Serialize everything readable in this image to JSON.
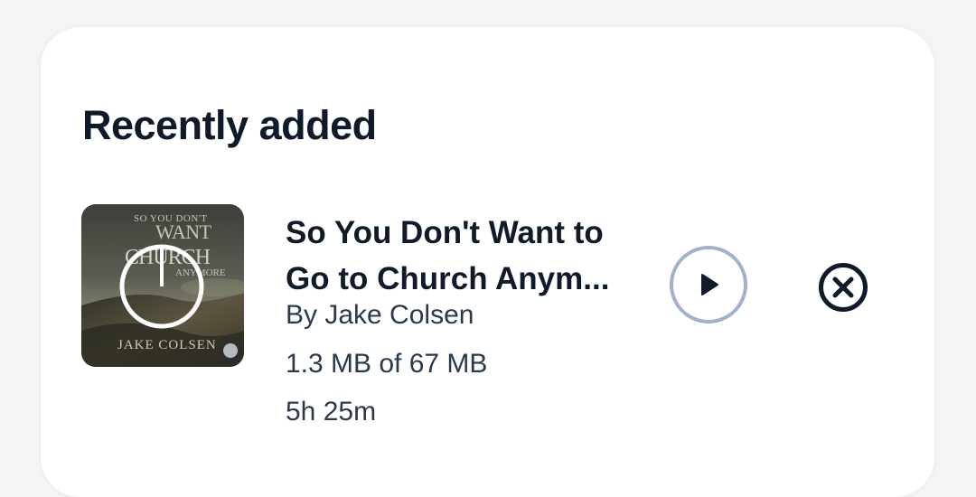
{
  "section": {
    "title": "Recently added"
  },
  "book": {
    "title_line1": "So You Don't Want to",
    "title_line2": "Go to Church Anym...",
    "author": "By Jake Colsen",
    "download_progress": "1.3 MB of 67 MB",
    "download_fraction": 0.02,
    "duration": "5h 25m",
    "cover": {
      "line1": "SO YOU DON'T",
      "line2": "WANT",
      "line3": "CHURCH",
      "line4": "ANYMORE",
      "author": "JAKE COLSEN"
    }
  },
  "actions": {
    "play_icon": "play-icon",
    "remove_icon": "close-circle-icon"
  },
  "colors": {
    "title": "#0f1b2a",
    "meta": "#2a3a4d",
    "play_ring": "#9fb3cc"
  }
}
